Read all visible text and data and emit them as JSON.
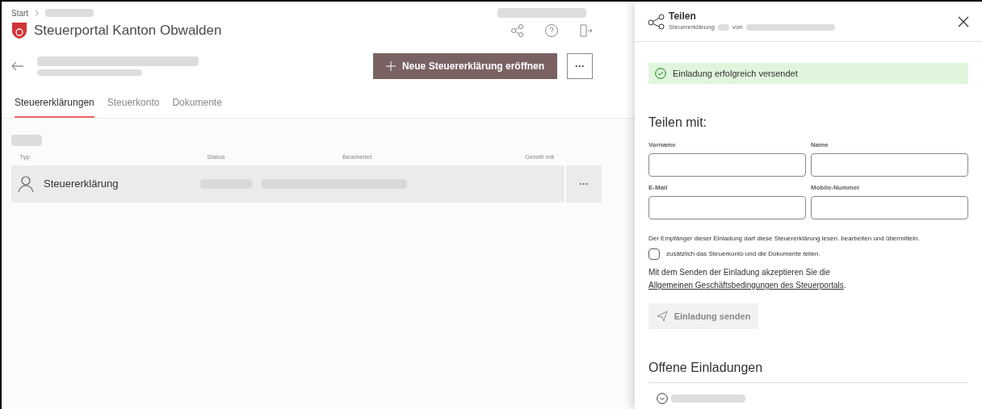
{
  "breadcrumb": {
    "label": "Start"
  },
  "header": {
    "title": "Steuerportal Kanton Obwalden"
  },
  "toolbar": {
    "primary_button": {
      "label": "Neue Steuererklärung eröffnen"
    },
    "more_button": {
      "label": "···"
    }
  },
  "tabs": [
    {
      "label": "Steuererklärungen",
      "selected": true
    },
    {
      "label": "Steuerkonto",
      "selected": false
    },
    {
      "label": "Dokumente",
      "selected": false
    }
  ],
  "table": {
    "columns": [
      "Typ",
      "Status",
      "Bearbeitet",
      "Geteilt mit"
    ],
    "rows": [
      {
        "type": "Steuererklärung",
        "more": "···"
      }
    ]
  },
  "panel": {
    "title": "Teilen",
    "subtitle": [
      "Steuererklärung",
      "von"
    ],
    "success_message": "Einladung erfolgreich versendet",
    "section_title": "Teilen mit:",
    "fields": [
      {
        "label": "Vorname"
      },
      {
        "label": "Name"
      },
      {
        "label": "E-Mail"
      },
      {
        "label": "Mobile-Nummer"
      }
    ],
    "info": "Der Empfänger dieser Einladung darf diese Steuererklärung lesen. bearbeiten und übermitteln.",
    "checkbox": {
      "label": "zusätzlich das Steuerkonto und die Dokumente teilen.",
      "checked": false
    },
    "terms": {
      "text": "Mit dem Senden der Einladung akzeptieren Sie die",
      "link": "Allgemeinen Geschäftsbedingungen des Steuerportals",
      "end": "."
    },
    "send_button": {
      "label": "Einladung senden",
      "disabled": true
    },
    "open_title": "Offene Einladungen"
  }
}
